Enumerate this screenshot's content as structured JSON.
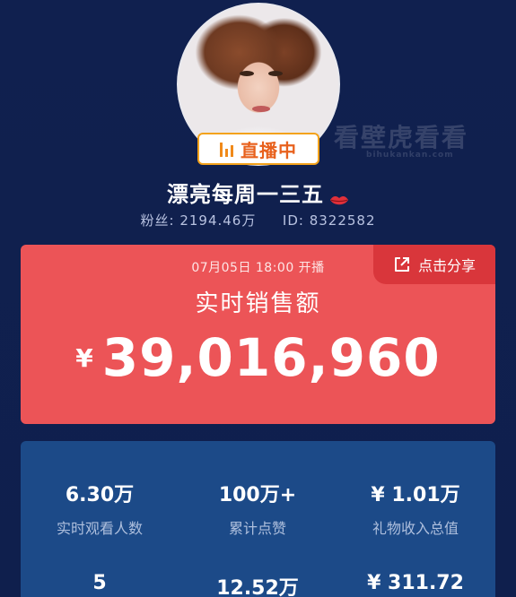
{
  "streamer": {
    "live_badge": "直播中",
    "name": "漂亮每周一三五",
    "fans_label": "粉丝:",
    "fans_value": "2194.46万",
    "id_label": "ID:",
    "id_value": "8322582"
  },
  "watermark": {
    "text": "看壁虎看看",
    "sub": "bihukankan.com"
  },
  "sales_card": {
    "start_time": "07月05日 18:00 开播",
    "share_label": "点击分享",
    "title": "实时销售额",
    "currency": "¥",
    "amount": "39,016,960"
  },
  "stats": {
    "row1": [
      {
        "value": "6.30万",
        "label": "实时观看人数"
      },
      {
        "value": "100万+",
        "label": "累计点赞"
      },
      {
        "value": "¥ 1.01万",
        "label": "礼物收入总值"
      }
    ],
    "row2": [
      {
        "value": "5",
        "label": ""
      },
      {
        "value": "12.52万",
        "label": ""
      },
      {
        "value": "¥ 311.72",
        "label": ""
      }
    ]
  },
  "colors": {
    "background": "#0f1e4d",
    "sales_card": "#ec5457",
    "share_button": "#d9363b",
    "stats_card": "#1c4a88",
    "live_badge_border": "#f3a21b",
    "live_badge_text": "#e8611d"
  },
  "icons": {
    "live": "live-bars-icon",
    "share": "share-external-icon",
    "lips": "lips-icon"
  }
}
